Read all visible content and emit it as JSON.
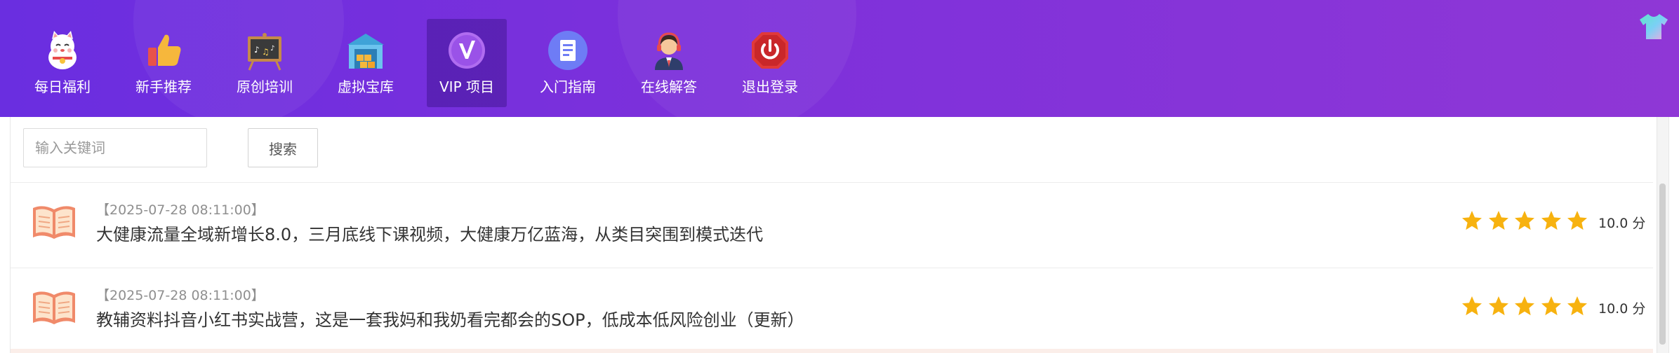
{
  "nav": {
    "items": [
      {
        "label": "每日福利",
        "icon": "lucky-cat-icon"
      },
      {
        "label": "新手推荐",
        "icon": "thumbs-up-icon"
      },
      {
        "label": "原创培训",
        "icon": "blackboard-icon"
      },
      {
        "label": "虚拟宝库",
        "icon": "warehouse-icon"
      },
      {
        "label": "VIP 项目",
        "icon": "vip-icon",
        "active": true
      },
      {
        "label": "入门指南",
        "icon": "document-icon"
      },
      {
        "label": "在线解答",
        "icon": "support-agent-icon"
      },
      {
        "label": "退出登录",
        "icon": "power-icon"
      }
    ],
    "skin_icon": "tshirt-icon"
  },
  "search": {
    "placeholder": "输入关键词",
    "button_label": "搜索"
  },
  "list": {
    "items": [
      {
        "time": "【2025-07-28 08:11:00】",
        "title": "大健康流量全域新增长8.0，三月底线下课视频，大健康万亿蓝海，从类目突围到模式迭代",
        "rating": 5,
        "score": "10.0 分"
      },
      {
        "time": "【2025-07-28 08:11:00】",
        "title": "教辅资料抖音小红书实战营，这是一套我妈和我奶看完都会的SOP，低成本低风险创业（更新）",
        "rating": 5,
        "score": "10.0 分"
      }
    ]
  },
  "colors": {
    "header_gradient_start": "#6a2ee0",
    "header_gradient_end": "#8f37d6",
    "star": "#f7b20f",
    "book": "#f08a6a"
  }
}
